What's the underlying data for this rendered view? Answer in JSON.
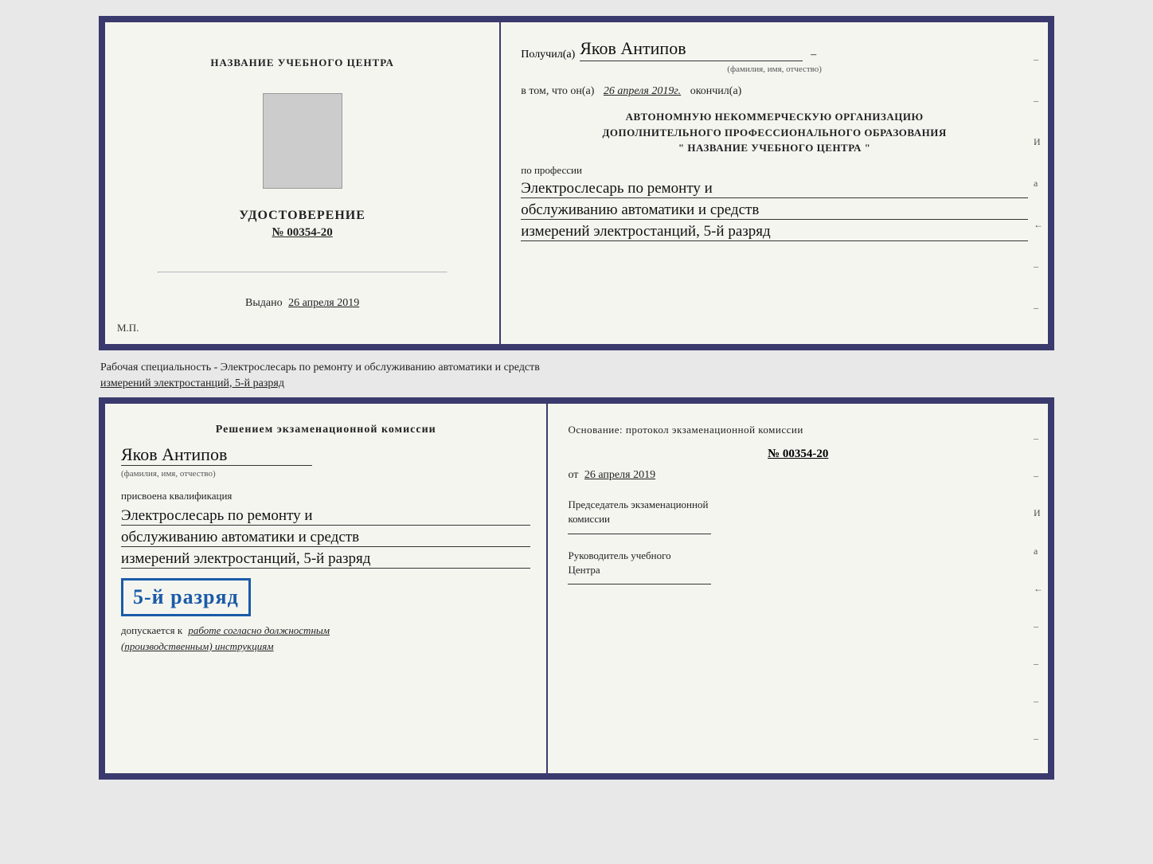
{
  "top_doc": {
    "left": {
      "org_name": "НАЗВАНИЕ УЧЕБНОГО ЦЕНТРА",
      "cert_title": "УДОСТОВЕРЕНИЕ",
      "cert_number": "№ 00354-20",
      "issued_label": "Выдано",
      "issued_date": "26 апреля 2019",
      "mp_label": "М.П."
    },
    "right": {
      "recipient_prefix": "Получил(а)",
      "recipient_name": "Яков Антипов",
      "fio_label": "(фамилия, имя, отчество)",
      "date_line_prefix": "в том, что он(а)",
      "date_value": "26 апреля 2019г.",
      "date_line_suffix": "окончил(а)",
      "org_block_line1": "АВТОНОМНУЮ НЕКОММЕРЧЕСКУЮ ОРГАНИЗАЦИЮ",
      "org_block_line2": "ДОПОЛНИТЕЛЬНОГО ПРОФЕССИОНАЛЬНОГО ОБРАЗОВАНИЯ",
      "org_block_quote": "\"   НАЗВАНИЕ УЧЕБНОГО ЦЕНТРА   \"",
      "profession_label": "по профессии",
      "profession_line1": "Электрослесарь по ремонту и",
      "profession_line2": "обслуживанию автоматики и средств",
      "profession_line3": "измерений электростанций, 5-й разряд",
      "right_marks": [
        "-",
        "-",
        "-",
        "И",
        "а",
        "←",
        "-",
        "-",
        "-",
        "-",
        "-"
      ]
    }
  },
  "middle_text": {
    "line1": "Рабочая специальность - Электрослесарь по ремонту и обслуживанию автоматики и средств",
    "line2": "измерений электростанций, 5-й разряд"
  },
  "bottom_doc": {
    "left": {
      "commission_title": "Решением экзаменационной комиссии",
      "person_name": "Яков Антипов",
      "fio_label": "(фамилия, имя, отчество)",
      "qualification_label": "присвоена квалификация",
      "qual_line1": "Электрослесарь по ремонту и",
      "qual_line2": "обслуживанию автоматики и средств",
      "qual_line3": "измерений электростанций, 5-й разряд",
      "rank_badge": "5-й разряд",
      "allowed_prefix": "допускается к",
      "allowed_cursive": "работе согласно должностным",
      "allowed_italic": "(производственным) инструкциям"
    },
    "right": {
      "basis_label": "Основание: протокол экзаменационной  комиссии",
      "protocol_number": "№  00354-20",
      "protocol_date_prefix": "от",
      "protocol_date": "26 апреля 2019",
      "chairman_title_line1": "Председатель экзаменационной",
      "chairman_title_line2": "комиссии",
      "director_title_line1": "Руководитель учебного",
      "director_title_line2": "Центра",
      "right_marks": [
        "-",
        "-",
        "-",
        "И",
        "а",
        "←",
        "-",
        "-",
        "-",
        "-",
        "-"
      ]
    }
  }
}
